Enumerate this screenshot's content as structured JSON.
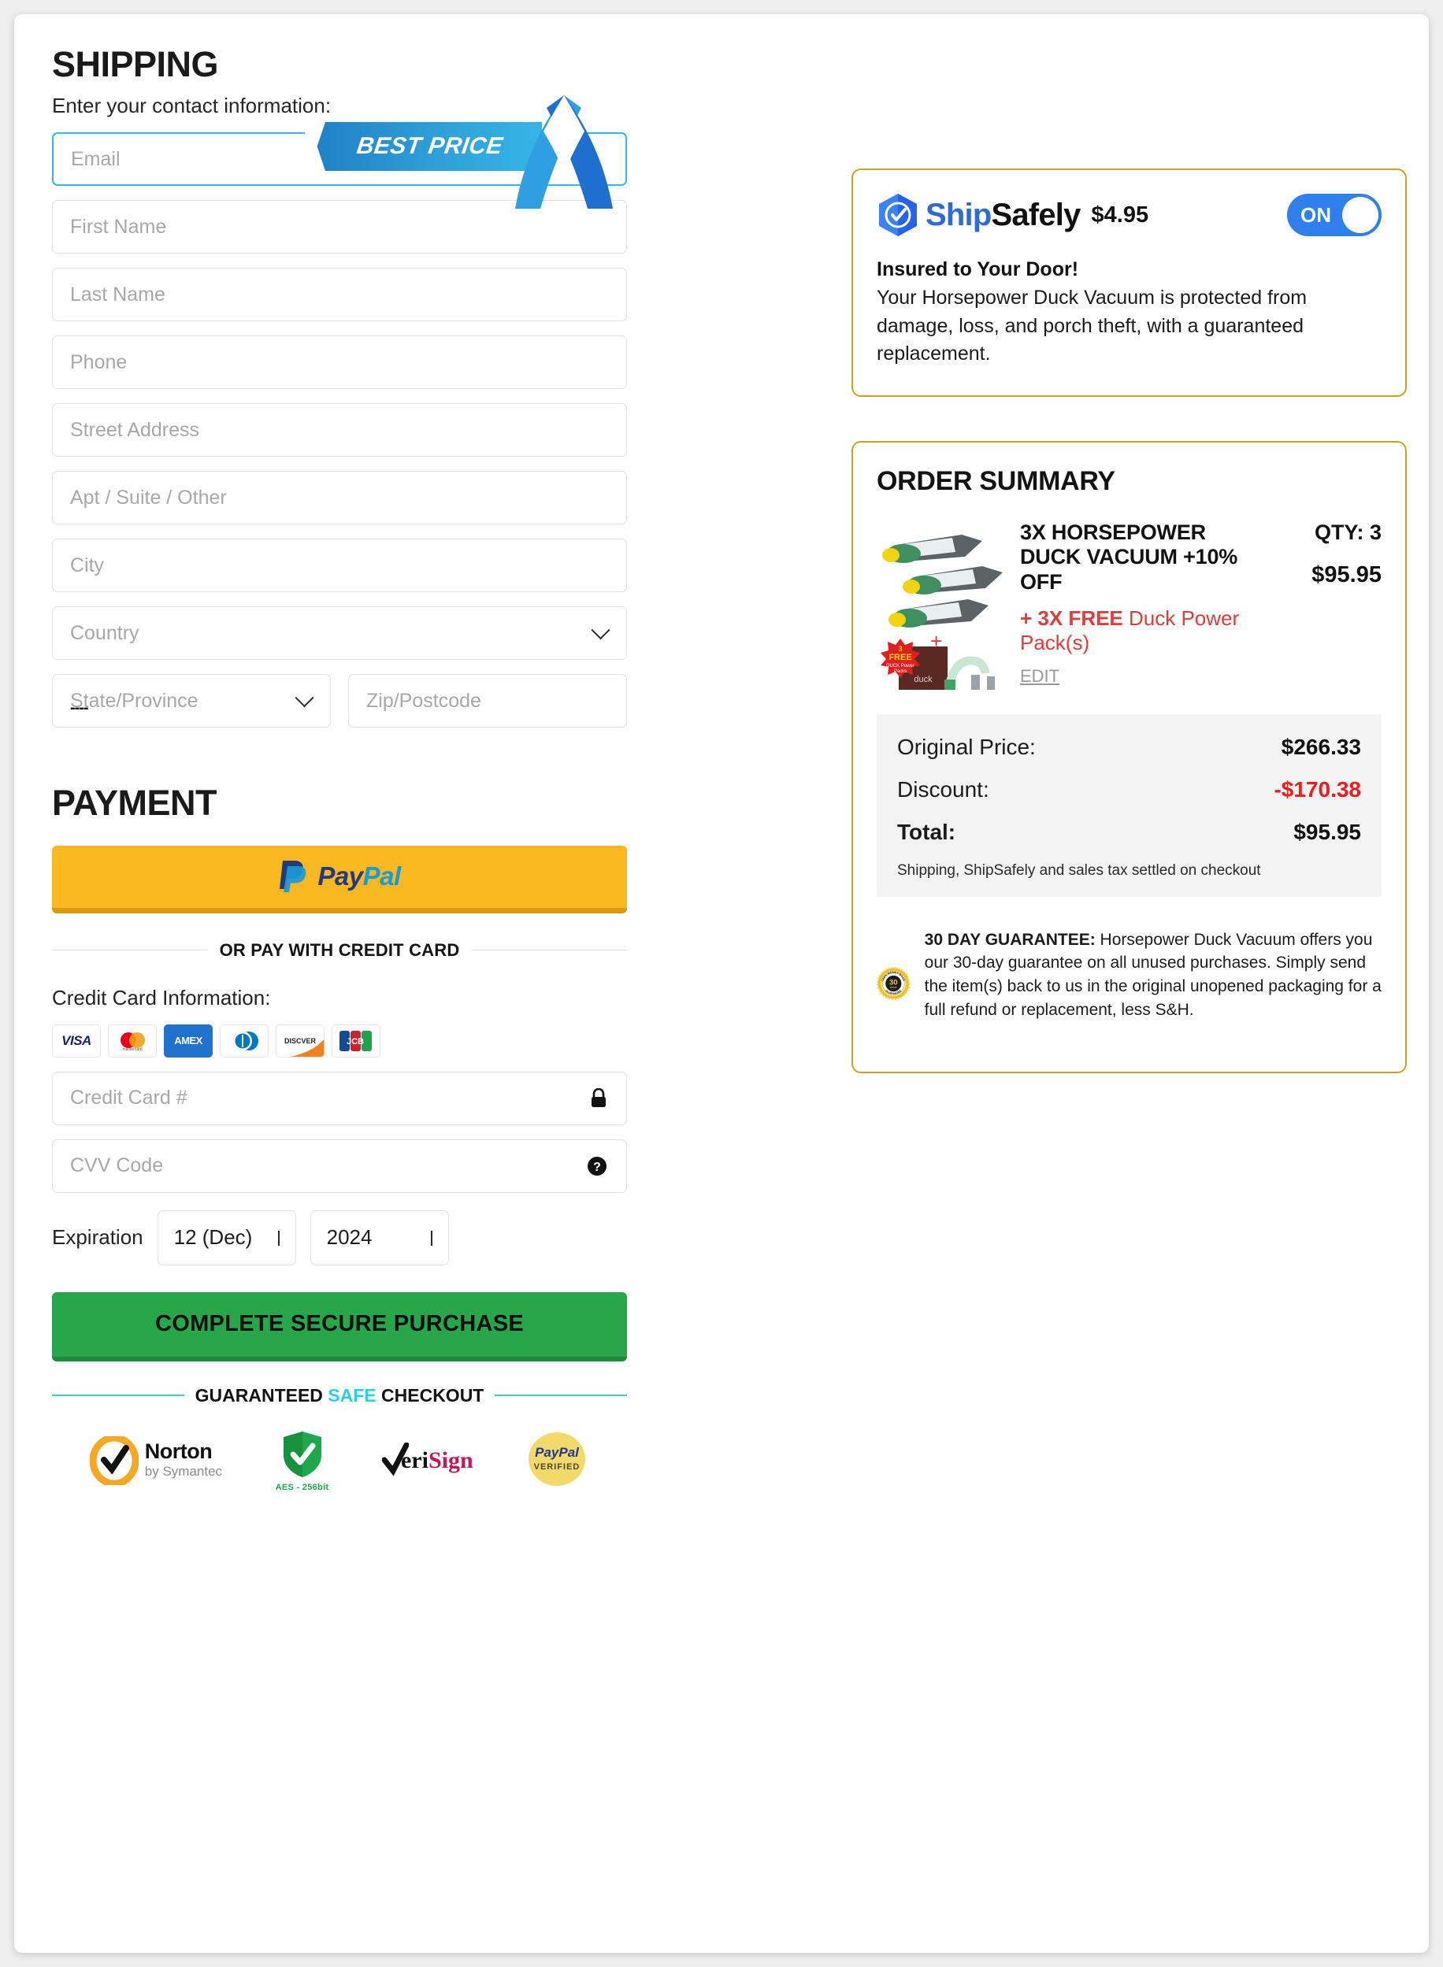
{
  "shipping": {
    "title": "SHIPPING",
    "subtitle": "Enter your contact information:",
    "ribbon_label": "BEST PRICE",
    "fields": [
      {
        "placeholder": "Email"
      },
      {
        "placeholder": "First Name"
      },
      {
        "placeholder": "Last Name"
      },
      {
        "placeholder": "Phone"
      },
      {
        "placeholder": "Street Address"
      },
      {
        "placeholder": "Apt / Suite / Other"
      },
      {
        "placeholder": "City"
      }
    ],
    "country_placeholder": "Country",
    "state_placeholder": "State/Province",
    "state_marker": "----",
    "zip_placeholder": "Zip/Postcode"
  },
  "payment": {
    "title": "PAYMENT",
    "paypal_pay": "Pay",
    "paypal_pal": "Pal",
    "divider_text": "OR PAY WITH CREDIT CARD",
    "cc_label": "Credit Card Information:",
    "card_brands": [
      "VISA",
      "mastercard",
      "AMEX",
      "Diners Club",
      "DISCOVER",
      "JCB"
    ],
    "cc_number_placeholder": "Credit Card #",
    "cvv_placeholder": "CVV Code",
    "expiration_label": "Expiration",
    "exp_month": "12 (Dec)",
    "exp_year": "2024",
    "buy_button": "COMPLETE SECURE PURCHASE",
    "safe_prefix": "GUARANTEED ",
    "safe_highlight": "SAFE",
    "safe_suffix": " CHECKOUT",
    "badges": [
      "Norton by Symantec",
      "AES - 256bit",
      "VeriSign",
      "PayPal Verified"
    ]
  },
  "shipsafely": {
    "logo_first": "Ship",
    "logo_second": "Safely",
    "price": "$4.95",
    "toggle_state": "ON",
    "headline": "Insured to Your Door!",
    "body": "Your Horsepower Duck Vacuum is protected from damage, loss, and porch theft, with a guaranteed replacement."
  },
  "order": {
    "title": "ORDER SUMMARY",
    "item_name": "3X HORSEPOWER DUCK VACUUM +10% OFF",
    "item_free_bold": "+ 3X FREE",
    "item_free_rest": " Duck Power Pack(s)",
    "edit_label": "EDIT",
    "qty": "QTY: 3",
    "item_price": "$95.95",
    "free_badge_qty": "3",
    "free_badge_word": "FREE",
    "free_badge_sub": "DUCK Power Packs",
    "pouch_word": "duck",
    "totals": [
      {
        "label": "Original Price:",
        "amount": "$266.33",
        "kind": "normal"
      },
      {
        "label": "Discount:",
        "amount": "-$170.38",
        "kind": "disc"
      },
      {
        "label": "Total:",
        "amount": "$95.95",
        "kind": "total"
      }
    ],
    "totals_note": "Shipping, ShipSafely and sales tax settled on checkout",
    "guarantee_bold": "30 DAY GUARANTEE:",
    "guarantee_text": " Horsepower Duck Vacuum offers you our 30-day guarantee on all unused purchases. Simply send the item(s) back to us in the original unopened packaging for a full refund or replacement, less S&H.",
    "seal_top": "100% MONEY BACK",
    "seal_num": "30",
    "seal_days": "DAYS",
    "seal_bottom": "GUARANTEE"
  },
  "colors": {
    "accent_gold": "#c9a227",
    "toggle_blue": "#2f80ed",
    "discount_red": "#ee1c1c",
    "buy_green": "#27a74a",
    "paypal_yellow": "#f9b720",
    "focus_cyan": "#35b8e8"
  }
}
